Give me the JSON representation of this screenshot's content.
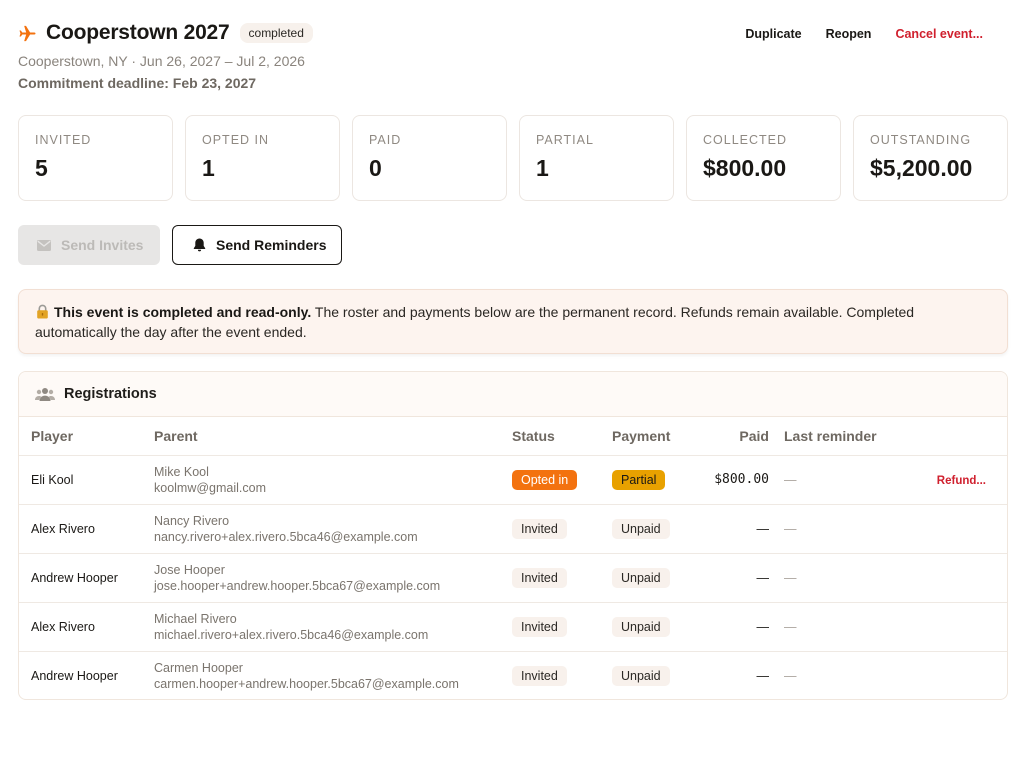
{
  "event": {
    "title": "Cooperstown 2027",
    "status": "completed",
    "subtitle": "Cooperstown, NY · Jun 26, 2027 – Jul 2, 2026",
    "deadline": "Commitment deadline: Feb 23, 2027",
    "icon": "airplane-icon"
  },
  "header_actions": {
    "duplicate": "Duplicate",
    "reopen": "Reopen",
    "cancel": "Cancel event..."
  },
  "stats": [
    {
      "label": "INVITED",
      "value": "5"
    },
    {
      "label": "OPTED IN",
      "value": "1"
    },
    {
      "label": "PAID",
      "value": "0"
    },
    {
      "label": "PARTIAL",
      "value": "1"
    },
    {
      "label": "COLLECTED",
      "value": "$800.00"
    },
    {
      "label": "OUTSTANDING",
      "value": "$5,200.00"
    }
  ],
  "actions": {
    "send_invites": "Send Invites",
    "send_reminders": "Send Reminders"
  },
  "notice": {
    "bold": "This event is completed and read-only.",
    "text": " The roster and payments below are the permanent record. Refunds remain available. Completed automatically the day after the event ended."
  },
  "registrations": {
    "title": "Registrations",
    "columns": {
      "player": "Player",
      "parent": "Parent",
      "status": "Status",
      "payment": "Payment",
      "paid": "Paid",
      "last_reminder": "Last reminder"
    },
    "rows": [
      {
        "player": "Eli Kool",
        "parent_name": "Mike Kool",
        "parent_email": "koolmw@gmail.com",
        "status": "Opted in",
        "payment": "Partial",
        "paid": "$800.00",
        "last_reminder": "—",
        "action": "Refund..."
      },
      {
        "player": "Alex Rivero",
        "parent_name": "Nancy Rivero",
        "parent_email": "nancy.rivero+alex.rivero.5bca46@example.com",
        "status": "Invited",
        "payment": "Unpaid",
        "paid": "—",
        "last_reminder": "—",
        "action": ""
      },
      {
        "player": "Andrew Hooper",
        "parent_name": "Jose Hooper",
        "parent_email": "jose.hooper+andrew.hooper.5bca67@example.com",
        "status": "Invited",
        "payment": "Unpaid",
        "paid": "—",
        "last_reminder": "—",
        "action": ""
      },
      {
        "player": "Alex Rivero",
        "parent_name": "Michael Rivero",
        "parent_email": "michael.rivero+alex.rivero.5bca46@example.com",
        "status": "Invited",
        "payment": "Unpaid",
        "paid": "—",
        "last_reminder": "—",
        "action": ""
      },
      {
        "player": "Andrew Hooper",
        "parent_name": "Carmen Hooper",
        "parent_email": "carmen.hooper+andrew.hooper.5bca67@example.com",
        "status": "Invited",
        "payment": "Unpaid",
        "paid": "—",
        "last_reminder": "—",
        "action": ""
      }
    ]
  },
  "colors": {
    "accent_orange": "#f3720f",
    "partial_amber": "#e8a100",
    "danger_red": "#d0202e"
  }
}
